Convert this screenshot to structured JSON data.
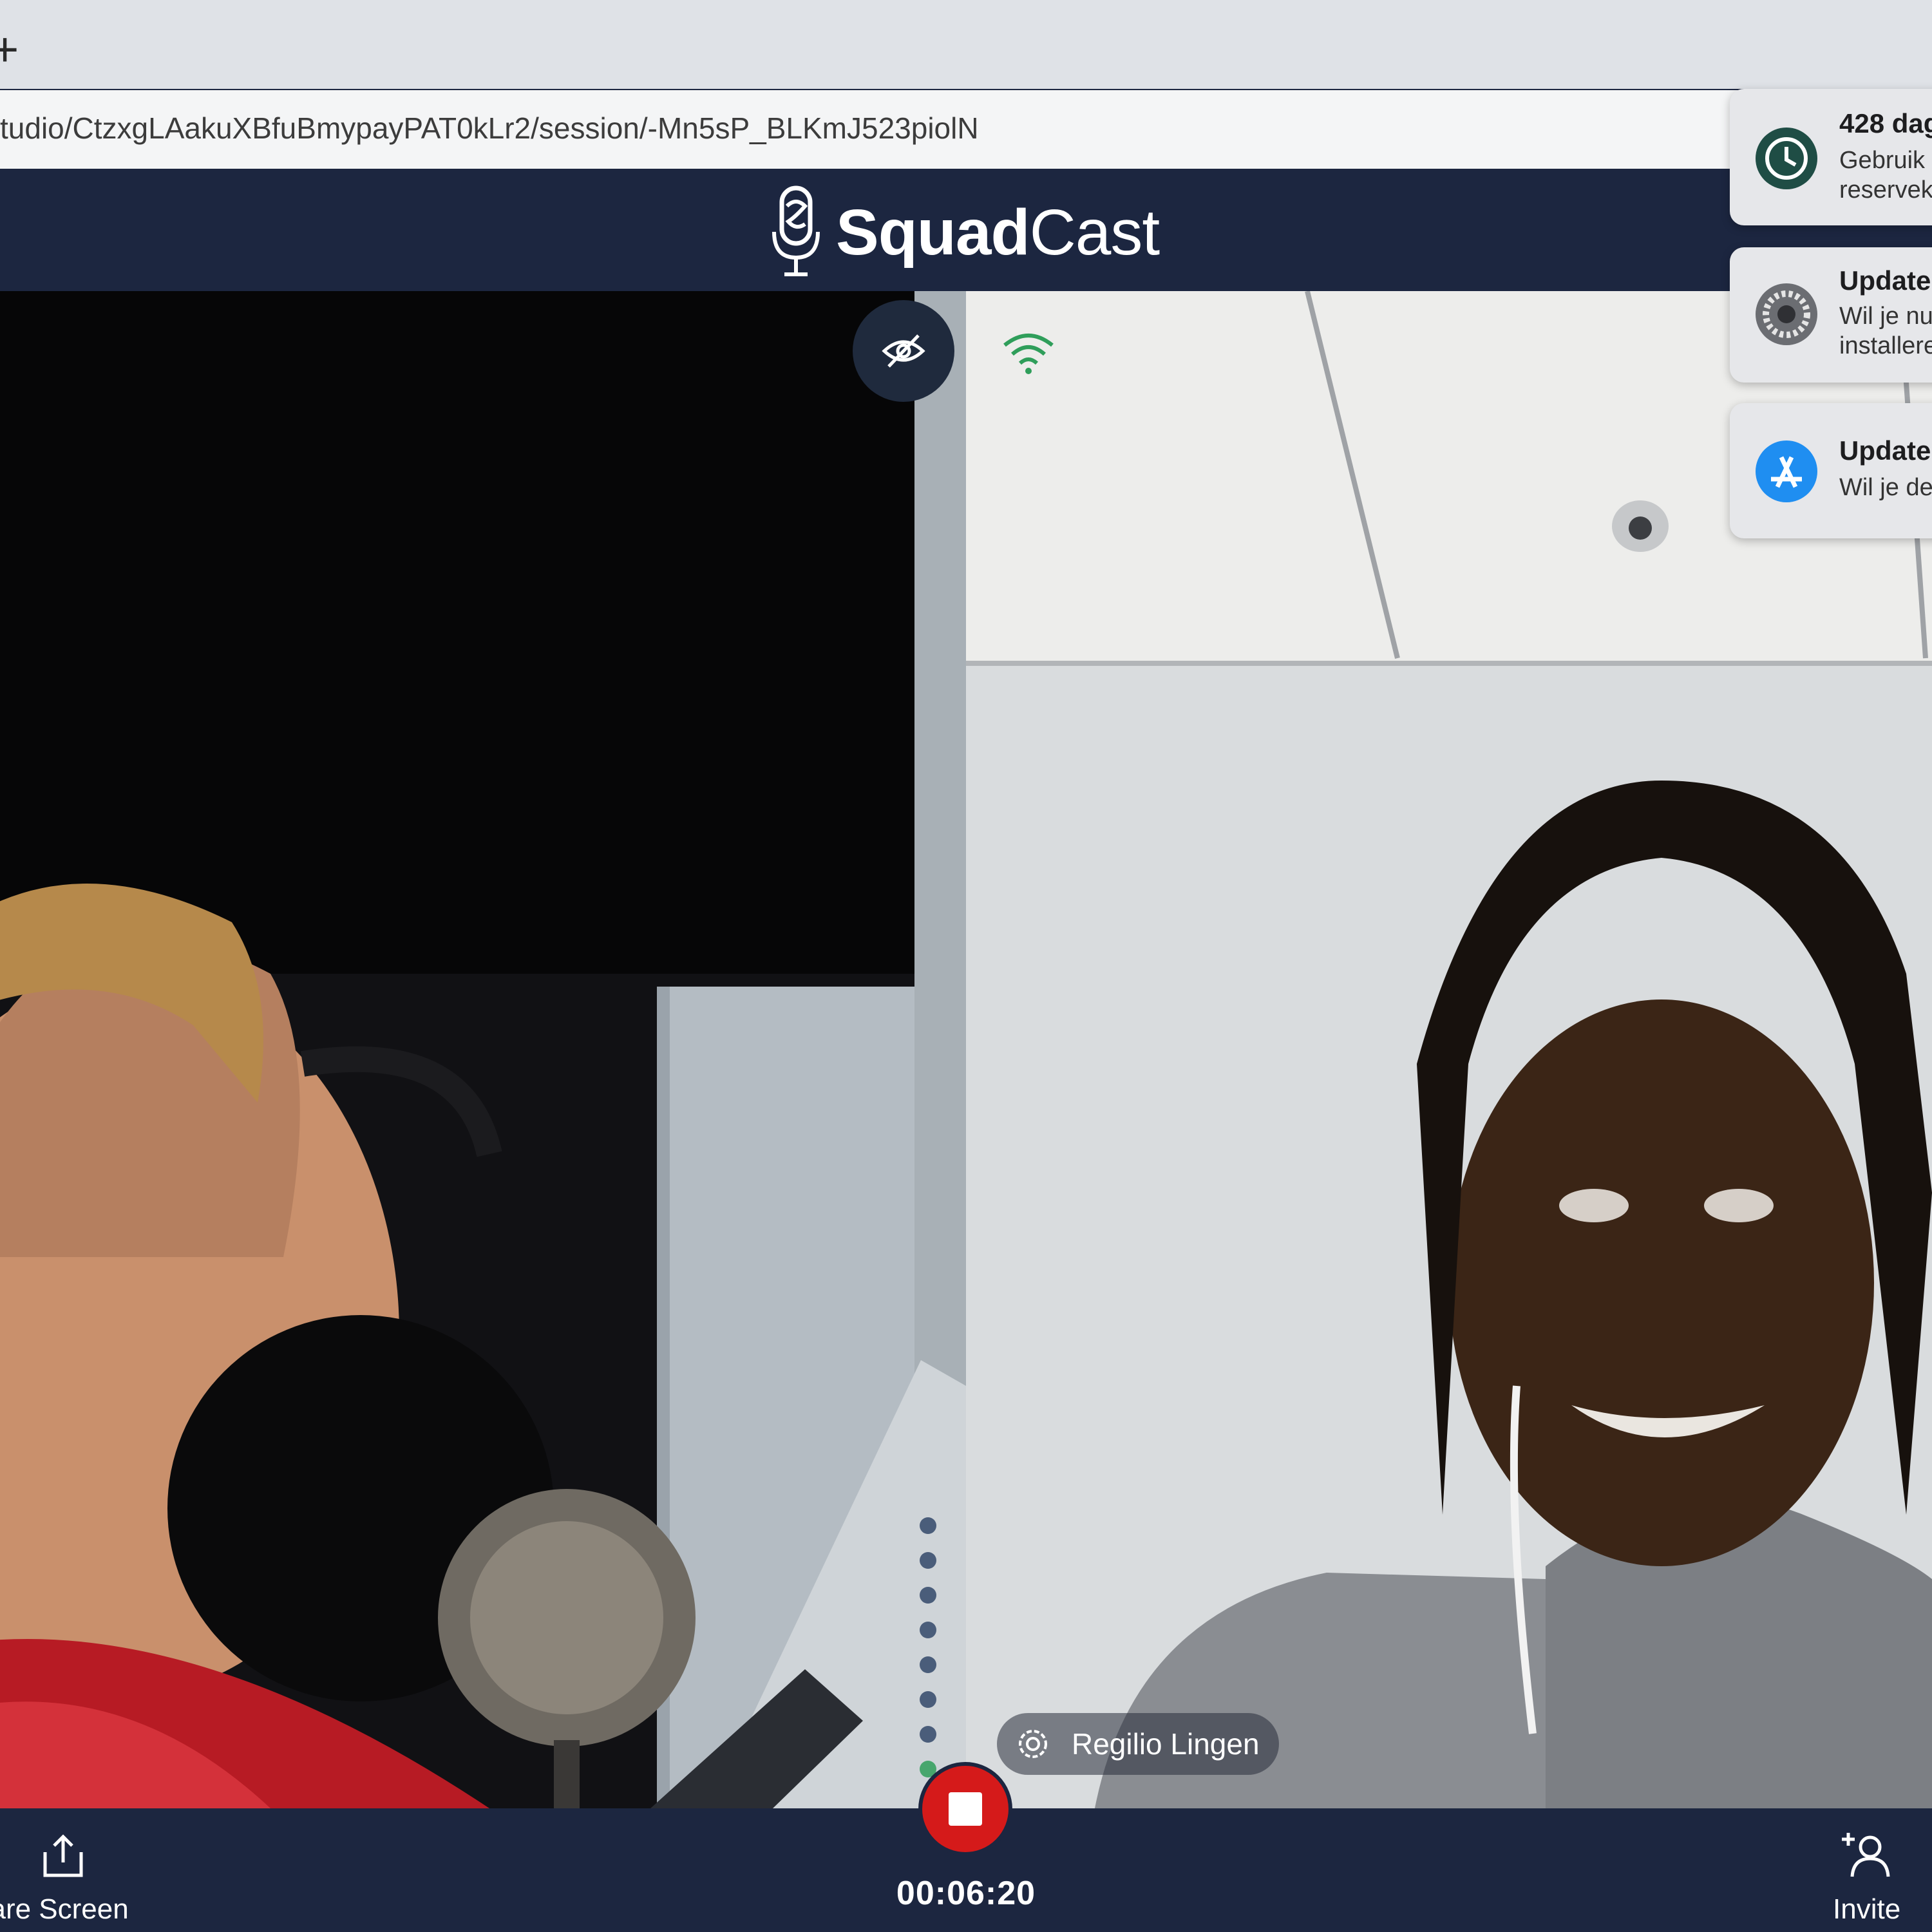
{
  "browser": {
    "new_tab_label": "+",
    "url": "tudio/CtzxgLAakuXBfuBmypayPAT0kLr2/session/-Mn5sP_BLKmJ523piolN"
  },
  "app": {
    "brand_bold": "Squad",
    "brand_light": "Cast"
  },
  "participants": {
    "remote_name": "Regilio Lingen"
  },
  "controls": {
    "share_label": "hare Screen",
    "invite_label": "Invite",
    "timer": "00:06:20"
  },
  "notifications": [
    {
      "title": "428 dag",
      "line1": "Gebruik",
      "line2": "reservek",
      "icon": "time-machine-icon"
    },
    {
      "title": "Update",
      "line1": "Wil je nu",
      "line2": "installere",
      "icon": "system-preferences-icon"
    },
    {
      "title": "Update",
      "line1": "Wil je de",
      "line2": "",
      "icon": "app-store-icon"
    }
  ],
  "colors": {
    "navy": "#1c2640",
    "record_red": "#d51a1a",
    "signal_green": "#2f9e5a"
  }
}
